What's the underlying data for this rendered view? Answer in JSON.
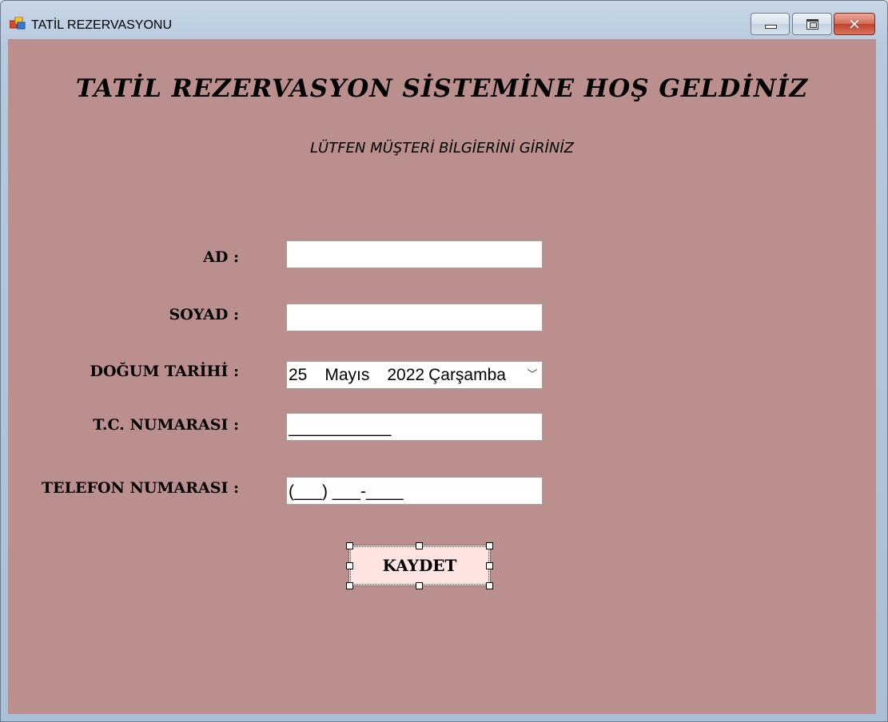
{
  "window": {
    "title": "TATİL REZERVASYONU",
    "icons": {
      "app": "app-window-icon",
      "minimize": "minimize-icon",
      "maximize": "maximize-icon",
      "close": "close-icon"
    },
    "close_glyph": "✕"
  },
  "form": {
    "background_color": "#bc8f8f",
    "heading": "TATİL REZERVASYON SİSTEMİNE HOŞ GELDİNİZ",
    "subheading": "LÜTFEN MÜŞTERİ BİLGİERİNİ GİRİNİZ",
    "fields": {
      "ad": {
        "label": "AD :",
        "value": ""
      },
      "soyad": {
        "label": "SOYAD :",
        "value": ""
      },
      "dogum_tarihi": {
        "label": "DOĞUM TARİHİ :",
        "day": "25",
        "month": "Mayıs",
        "year": "2022",
        "weekday": "Çarşamba",
        "dropdown_glyph": "﹀"
      },
      "tc_numarasi": {
        "label": "T.C. NUMARASI :",
        "value": "___________"
      },
      "telefon_numarasi": {
        "label": "TELEFON NUMARASI :",
        "value": "(___) ___-____"
      }
    },
    "save_button": {
      "label": "KAYDET",
      "button_color": "#ffe4e1"
    }
  }
}
